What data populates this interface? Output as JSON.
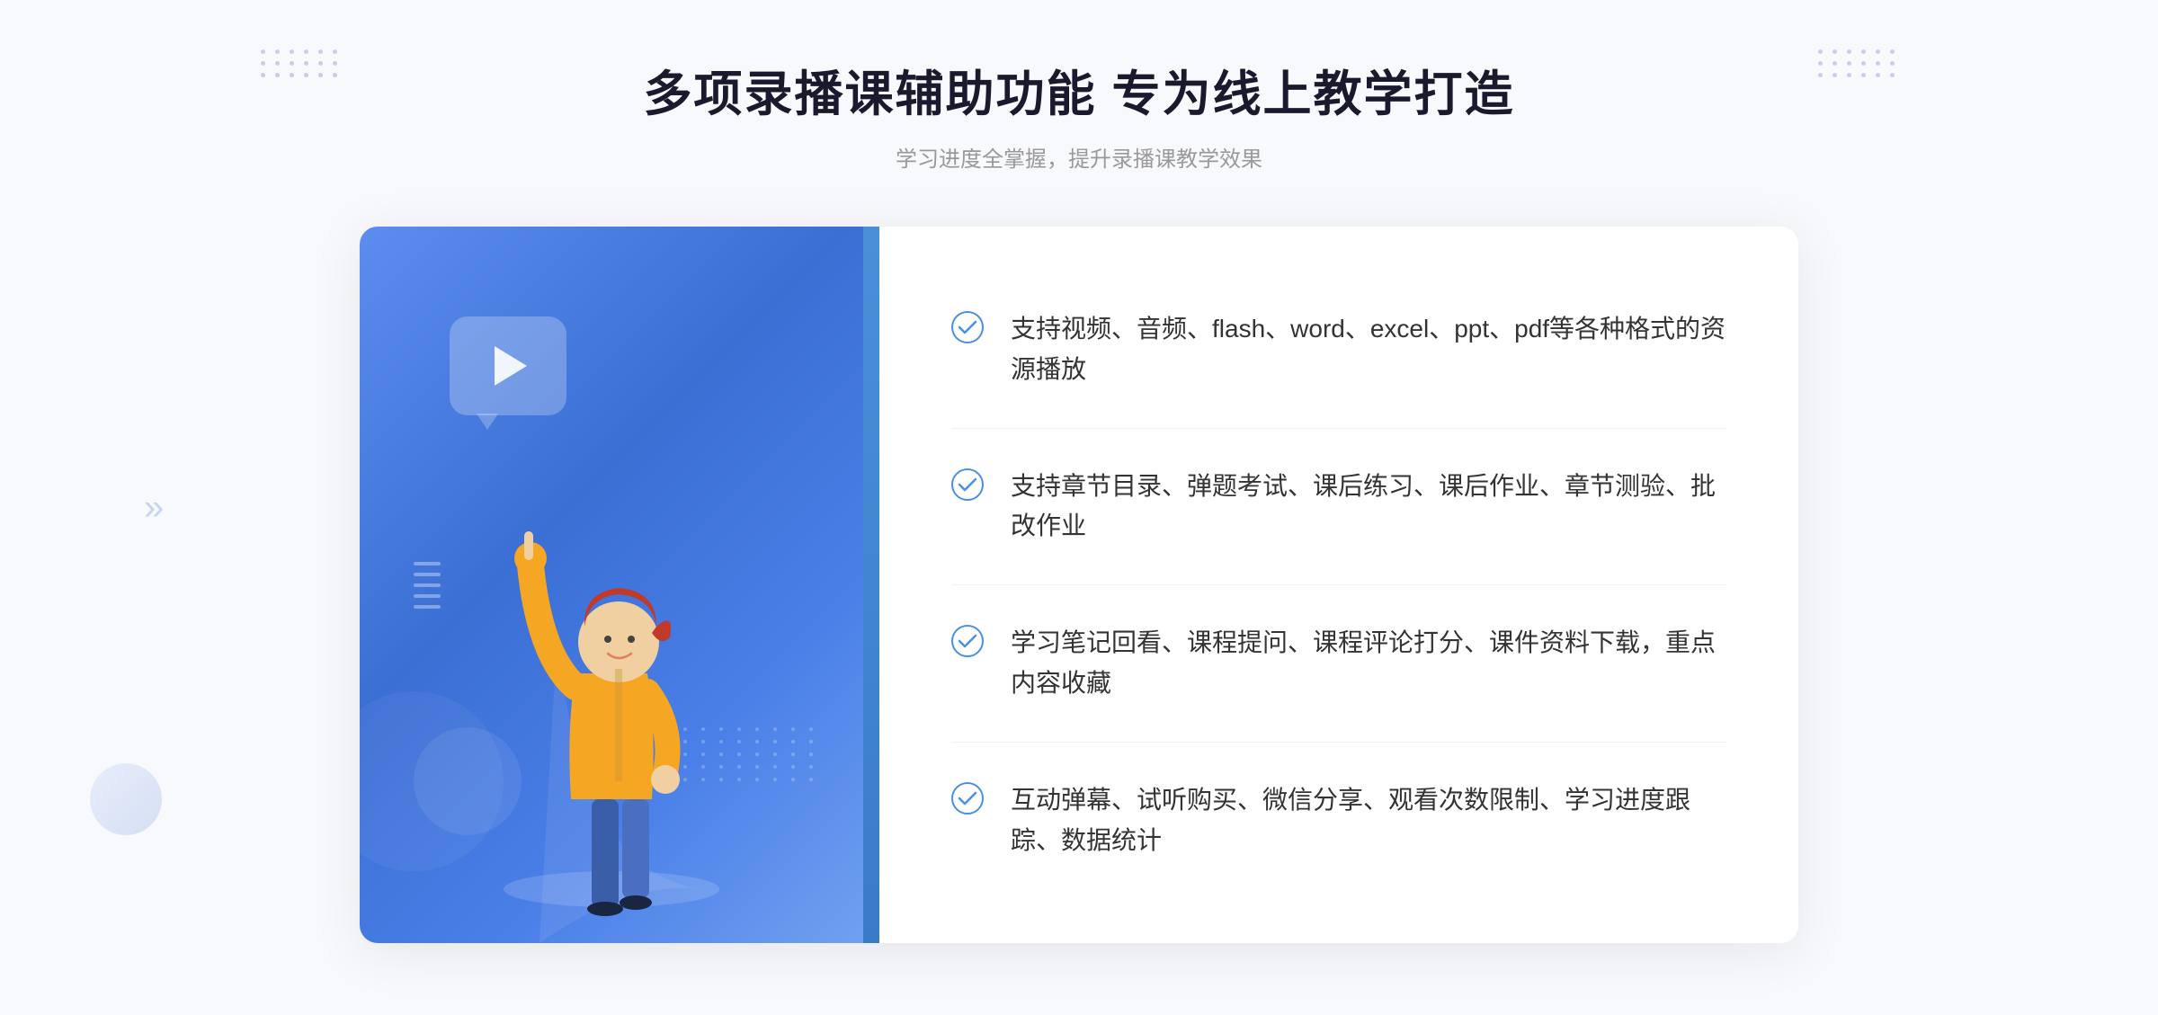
{
  "header": {
    "title": "多项录播课辅助功能 专为线上教学打造",
    "subtitle": "学习进度全掌握，提升录播课教学效果",
    "dots_decoration": true
  },
  "features": [
    {
      "id": 1,
      "text": "支持视频、音频、flash、word、excel、ppt、pdf等各种格式的资源播放"
    },
    {
      "id": 2,
      "text": "支持章节目录、弹题考试、课后练习、课后作业、章节测验、批改作业"
    },
    {
      "id": 3,
      "text": "学习笔记回看、课程提问、课程评论打分、课件资料下载，重点内容收藏"
    },
    {
      "id": 4,
      "text": "互动弹幕、试听购买、微信分享、观看次数限制、学习进度跟踪、数据统计"
    }
  ],
  "illustration": {
    "play_bubble": true,
    "person": true
  },
  "colors": {
    "primary_blue": "#4a7fe8",
    "light_blue": "#e8f0ff",
    "text_dark": "#1a1a2e",
    "text_gray": "#999999",
    "text_body": "#333333",
    "check_blue": "#4a90e2"
  }
}
